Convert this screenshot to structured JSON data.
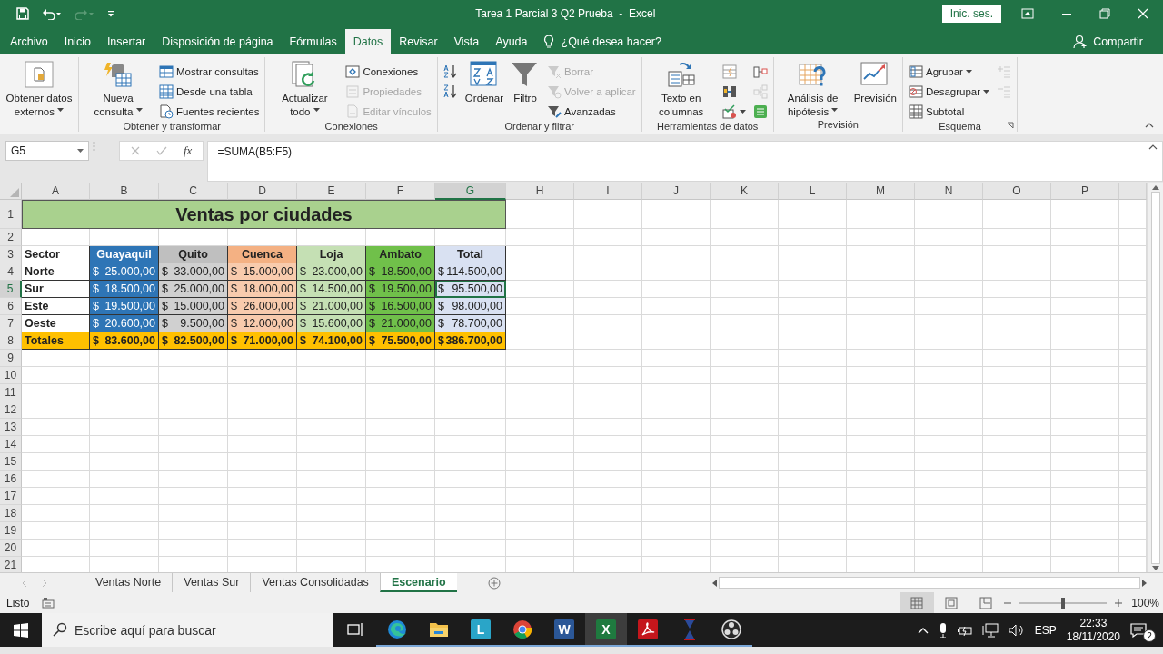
{
  "window": {
    "title": "Tarea 1 Parcial 3 Q2 Prueba  -  Excel",
    "sign_in": "Inic. ses."
  },
  "menu_tabs": [
    {
      "label": "Archivo",
      "selected": false
    },
    {
      "label": "Inicio",
      "selected": false
    },
    {
      "label": "Insertar",
      "selected": false
    },
    {
      "label": "Disposición de página",
      "selected": false
    },
    {
      "label": "Fórmulas",
      "selected": false
    },
    {
      "label": "Datos",
      "selected": true
    },
    {
      "label": "Revisar",
      "selected": false
    },
    {
      "label": "Vista",
      "selected": false
    },
    {
      "label": "Ayuda",
      "selected": false
    }
  ],
  "tell_me": {
    "placeholder": "¿Qué desea hacer?"
  },
  "share": "Compartir",
  "ribbon": {
    "groups": [
      {
        "columns": [
          {
            "kind": "large",
            "label": "Obtener datos externos",
            "dropdown": true
          }
        ]
      },
      {
        "label": "Obtener y transformar",
        "columns": [
          {
            "kind": "large",
            "label": "Nueva consulta",
            "dropdown": true
          },
          {
            "kind": "stack",
            "items": [
              {
                "label": "Mostrar consultas",
                "disabled": false,
                "dropdown": false
              },
              {
                "label": "Desde una tabla",
                "disabled": false,
                "dropdown": false
              },
              {
                "label": "Fuentes recientes",
                "disabled": false,
                "dropdown": false
              }
            ]
          }
        ]
      },
      {
        "label": "Conexiones",
        "columns": [
          {
            "kind": "large",
            "label": "Actualizar todo",
            "dropdown": true
          },
          {
            "kind": "stack",
            "items": [
              {
                "label": "Conexiones",
                "disabled": false,
                "dropdown": false
              },
              {
                "label": "Propiedades",
                "disabled": true,
                "dropdown": false
              },
              {
                "label": "Editar vínculos",
                "disabled": true,
                "dropdown": false
              }
            ]
          }
        ]
      },
      {
        "label": "Ordenar y filtrar",
        "columns": [
          {
            "kind": "stack",
            "items": [
              {
                "disabled": false,
                "dropdown": false
              },
              {
                "disabled": false,
                "dropdown": false
              }
            ]
          },
          {
            "kind": "large",
            "label": "Ordenar",
            "dropdown": false
          },
          {
            "kind": "large",
            "label": "Filtro",
            "dropdown": false
          },
          {
            "kind": "stack",
            "items": [
              {
                "label": "Borrar",
                "disabled": true,
                "dropdown": false
              },
              {
                "label": "Volver a aplicar",
                "disabled": true,
                "dropdown": false
              },
              {
                "label": "Avanzadas",
                "disabled": false,
                "dropdown": false
              }
            ]
          }
        ]
      },
      {
        "label": "Herramientas de datos",
        "columns": [
          {
            "kind": "large",
            "label": "Texto en columnas",
            "dropdown": false
          },
          {
            "kind": "stack",
            "items": [
              {
                "disabled": false,
                "dropdown": false
              },
              {
                "disabled": false,
                "dropdown": false
              },
              {
                "disabled": false,
                "dropdown": true
              }
            ]
          },
          {
            "kind": "stack",
            "items": [
              {
                "disabled": false,
                "dropdown": false
              },
              {
                "disabled": true,
                "dropdown": false
              },
              {
                "disabled": false,
                "dropdown": false
              }
            ]
          }
        ]
      },
      {
        "label": "Previsión",
        "columns": [
          {
            "kind": "large",
            "label": "Análisis de hipótesis",
            "dropdown": true
          },
          {
            "kind": "large",
            "label": "Previsión",
            "dropdown": false
          }
        ]
      },
      {
        "label": "Esquema",
        "launcher": true,
        "columns": [
          {
            "kind": "stack",
            "items": [
              {
                "label": "Agrupar",
                "disabled": false,
                "dropdown": true
              },
              {
                "label": "Desagrupar",
                "disabled": false,
                "dropdown": true
              },
              {
                "label": "Subtotal",
                "disabled": false,
                "dropdown": false
              }
            ]
          },
          {
            "kind": "stack",
            "items": [
              {
                "disabled": true,
                "dropdown": false
              },
              {
                "disabled": true,
                "dropdown": false
              }
            ]
          }
        ]
      }
    ]
  },
  "formula_bar": {
    "name_box": "G5",
    "function_button": "fx",
    "formula": "=SUMA(B5:F5)"
  },
  "grid": {
    "columns": [
      {
        "label": "A",
        "selected": false
      },
      {
        "label": "B",
        "selected": false
      },
      {
        "label": "C",
        "selected": false
      },
      {
        "label": "D",
        "selected": false
      },
      {
        "label": "E",
        "selected": false
      },
      {
        "label": "F",
        "selected": false
      },
      {
        "label": "G",
        "selected": true
      },
      {
        "label": "H",
        "selected": false
      },
      {
        "label": "I",
        "selected": false
      },
      {
        "label": "J",
        "selected": false
      },
      {
        "label": "K",
        "selected": false
      },
      {
        "label": "L",
        "selected": false
      },
      {
        "label": "M",
        "selected": false
      },
      {
        "label": "N",
        "selected": false
      },
      {
        "label": "O",
        "selected": false
      },
      {
        "label": "P",
        "selected": false
      }
    ],
    "rows": [
      {
        "label": "1",
        "selected": false,
        "kind": "title",
        "cells": [],
        "banner": {
          "text": "Ventas por ciudades",
          "color": "#a9d18e"
        }
      },
      {
        "label": "2",
        "selected": false,
        "kind": "empty",
        "cells": []
      },
      {
        "label": "3",
        "selected": false,
        "kind": "header",
        "cells": [
          {
            "kind": "text",
            "text": "Sector"
          },
          {
            "kind": "text",
            "text": "Guayaquil",
            "color": "#2e75b6"
          },
          {
            "kind": "text",
            "text": "Quito",
            "color": "#bfbfbf"
          },
          {
            "kind": "text",
            "text": "Cuenca",
            "color": "#f4b183"
          },
          {
            "kind": "text",
            "text": "Loja",
            "color": "#c5e0b4"
          },
          {
            "kind": "text",
            "text": "Ambato",
            "color": "#70c04a"
          },
          {
            "kind": "text",
            "text": "Total",
            "color": "#d9e1f2"
          }
        ]
      },
      {
        "label": "4",
        "selected": false,
        "kind": "data",
        "cells": [
          {
            "kind": "text",
            "text": "Norte"
          },
          {
            "kind": "money",
            "currency": "$",
            "amount": "25.000,00",
            "color": "#2e75b6"
          },
          {
            "kind": "money",
            "currency": "$",
            "amount": "33.000,00",
            "color": "#d0d0d0"
          },
          {
            "kind": "money",
            "currency": "$",
            "amount": "15.000,00",
            "color": "#f8cbad"
          },
          {
            "kind": "money",
            "currency": "$",
            "amount": "23.000,00",
            "color": "#c5e0b4"
          },
          {
            "kind": "money",
            "currency": "$",
            "amount": "18.500,00",
            "color": "#70c04a"
          },
          {
            "kind": "money",
            "currency": "$",
            "amount": "114.500,00",
            "color": "#d9e1f2"
          }
        ]
      },
      {
        "label": "5",
        "selected": true,
        "kind": "data",
        "cells": [
          {
            "kind": "text",
            "text": "Sur"
          },
          {
            "kind": "money",
            "currency": "$",
            "amount": "18.500,00",
            "color": "#2e75b6"
          },
          {
            "kind": "money",
            "currency": "$",
            "amount": "25.000,00",
            "color": "#d0d0d0"
          },
          {
            "kind": "money",
            "currency": "$",
            "amount": "18.000,00",
            "color": "#f8cbad"
          },
          {
            "kind": "money",
            "currency": "$",
            "amount": "14.500,00",
            "color": "#c5e0b4"
          },
          {
            "kind": "money",
            "currency": "$",
            "amount": "19.500,00",
            "color": "#70c04a"
          },
          {
            "kind": "money",
            "currency": "$",
            "amount": "95.500,00",
            "color": "#d9e1f2"
          }
        ]
      },
      {
        "label": "6",
        "selected": false,
        "kind": "data",
        "cells": [
          {
            "kind": "text",
            "text": "Este"
          },
          {
            "kind": "money",
            "currency": "$",
            "amount": "19.500,00",
            "color": "#2e75b6"
          },
          {
            "kind": "money",
            "currency": "$",
            "amount": "15.000,00",
            "color": "#d0d0d0"
          },
          {
            "kind": "money",
            "currency": "$",
            "amount": "26.000,00",
            "color": "#f8cbad"
          },
          {
            "kind": "money",
            "currency": "$",
            "amount": "21.000,00",
            "color": "#c5e0b4"
          },
          {
            "kind": "money",
            "currency": "$",
            "amount": "16.500,00",
            "color": "#70c04a"
          },
          {
            "kind": "money",
            "currency": "$",
            "amount": "98.000,00",
            "color": "#d9e1f2"
          }
        ]
      },
      {
        "label": "7",
        "selected": false,
        "kind": "data",
        "cells": [
          {
            "kind": "text",
            "text": "Oeste"
          },
          {
            "kind": "money",
            "currency": "$",
            "amount": "20.600,00",
            "color": "#2e75b6"
          },
          {
            "kind": "money",
            "currency": "$",
            "amount": "9.500,00",
            "color": "#d0d0d0"
          },
          {
            "kind": "money",
            "currency": "$",
            "amount": "12.000,00",
            "color": "#f8cbad"
          },
          {
            "kind": "money",
            "currency": "$",
            "amount": "15.600,00",
            "color": "#c5e0b4"
          },
          {
            "kind": "money",
            "currency": "$",
            "amount": "21.000,00",
            "color": "#70c04a"
          },
          {
            "kind": "money",
            "currency": "$",
            "amount": "78.700,00",
            "color": "#d9e1f2"
          }
        ]
      },
      {
        "label": "8",
        "selected": false,
        "kind": "totals",
        "cells": [
          {
            "kind": "text",
            "text": "Totales",
            "color": "#ffc000"
          },
          {
            "kind": "money",
            "currency": "$",
            "amount": "83.600,00",
            "color": "#ffc000"
          },
          {
            "kind": "money",
            "currency": "$",
            "amount": "82.500,00",
            "color": "#ffc000"
          },
          {
            "kind": "money",
            "currency": "$",
            "amount": "71.000,00",
            "color": "#ffc000"
          },
          {
            "kind": "money",
            "currency": "$",
            "amount": "74.100,00",
            "color": "#ffc000"
          },
          {
            "kind": "money",
            "currency": "$",
            "amount": "75.500,00",
            "color": "#ffc000"
          },
          {
            "kind": "money",
            "currency": "$",
            "amount": "386.700,00",
            "color": "#ffc000"
          }
        ]
      },
      {
        "label": "9",
        "selected": false,
        "kind": "empty",
        "cells": []
      },
      {
        "label": "10",
        "selected": false,
        "kind": "empty",
        "cells": []
      },
      {
        "label": "11",
        "selected": false,
        "kind": "empty",
        "cells": []
      },
      {
        "label": "12",
        "selected": false,
        "kind": "empty",
        "cells": []
      },
      {
        "label": "13",
        "selected": false,
        "kind": "empty",
        "cells": []
      },
      {
        "label": "14",
        "selected": false,
        "kind": "empty",
        "cells": []
      },
      {
        "label": "15",
        "selected": false,
        "kind": "empty",
        "cells": []
      },
      {
        "label": "16",
        "selected": false,
        "kind": "empty",
        "cells": []
      },
      {
        "label": "17",
        "selected": false,
        "kind": "empty",
        "cells": []
      },
      {
        "label": "18",
        "selected": false,
        "kind": "empty",
        "cells": []
      },
      {
        "label": "19",
        "selected": false,
        "kind": "empty",
        "cells": []
      },
      {
        "label": "20",
        "selected": false,
        "kind": "empty",
        "cells": []
      },
      {
        "label": "21",
        "selected": false,
        "kind": "empty",
        "cells": []
      }
    ]
  },
  "sheet_tabs": [
    {
      "label": "Ventas Norte",
      "selected": false
    },
    {
      "label": "Ventas Sur",
      "selected": false
    },
    {
      "label": "Ventas Consolidadas",
      "selected": false
    },
    {
      "label": "Escenario",
      "selected": true
    }
  ],
  "status_bar": {
    "status": "Listo",
    "views": [
      {
        "selected": true
      },
      {
        "selected": false
      },
      {
        "selected": false
      }
    ],
    "zoom": {
      "level": 0.5,
      "reading": "100%"
    }
  },
  "taskbar": {
    "search": {
      "placeholder": "Escribe aquí para buscar"
    },
    "apps": [
      {
        "kind": "taskview",
        "selected": false
      },
      {
        "kind": "browser",
        "selected": false
      },
      {
        "kind": "folder",
        "selected": false
      },
      {
        "kind": "tile",
        "glyph": "L",
        "color": "#2aa5c8",
        "selected": false
      },
      {
        "kind": "chrome",
        "selected": false
      },
      {
        "kind": "tile",
        "glyph": "W",
        "color": "#2b5797",
        "selected": false
      },
      {
        "kind": "tile",
        "glyph": "X",
        "color": "#1f7a3f",
        "selected": true
      },
      {
        "kind": "pdf",
        "selected": false
      },
      {
        "kind": "hourglass",
        "selected": false
      },
      {
        "kind": "ring",
        "selected": false
      }
    ],
    "language": "ESP",
    "time": "22:33",
    "date": "18/11/2020",
    "notifications": "2"
  }
}
